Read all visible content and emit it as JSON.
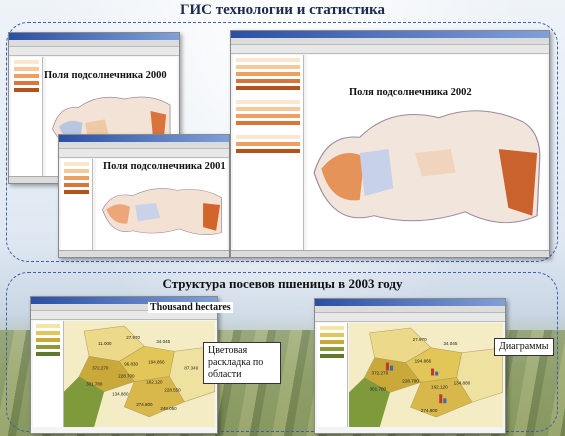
{
  "header": {
    "title": "ГИС технологии и статистика"
  },
  "top_section": {
    "windows": [
      {
        "caption": "Поля подсолнечника 2000"
      },
      {
        "caption": "Поля подсолнечника 2001"
      },
      {
        "caption": "Поля подсолнечника 2002"
      }
    ]
  },
  "bottom_section": {
    "title": "Структура посевов пшеницы в 2003 году",
    "left_label": "Thousand hectares",
    "left_callout": "Цветовая раскладка по области",
    "right_callout": "Диаграммы",
    "map_values_left": [
      "27.970",
      "11.000",
      "34.045",
      "372.270",
      "96.830",
      "194.866",
      "228.700",
      "301.780",
      "162.120",
      "228.550",
      "134.880",
      "87.340",
      "274.800",
      "248.050"
    ],
    "map_values_right": [
      "27.970",
      "34.045",
      "372.270",
      "194.866",
      "228.700",
      "301.780",
      "162.120",
      "134.880",
      "274.800"
    ]
  },
  "colors": {
    "accent": "#3d5fb0",
    "title": "#1a2a50",
    "map_orange": "#d9743a",
    "map_light": "#f2d9b8",
    "region_yellow": "#ecd98a",
    "region_olive": "#c9a93a"
  }
}
